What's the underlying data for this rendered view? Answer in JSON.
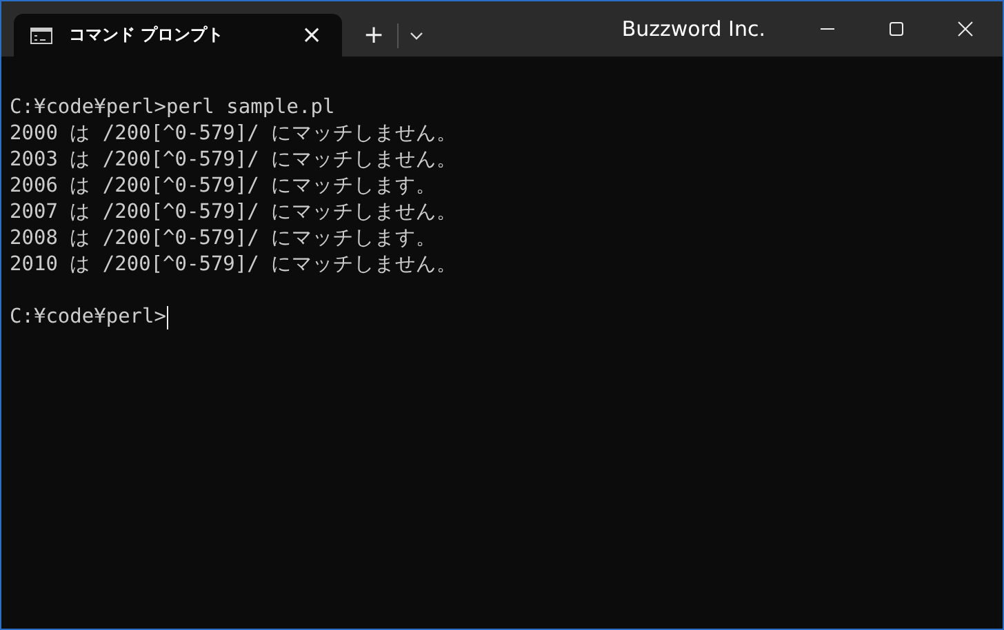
{
  "tabs": [
    {
      "title": "コマンド プロンプト",
      "close": "×",
      "selected": true
    }
  ],
  "new_tab": "+",
  "title_bar": {
    "text": "Buzzword Inc."
  },
  "console": {
    "command": {
      "prompt": "C:¥code¥perl>",
      "input": "perl sample.pl"
    },
    "output": [
      "2000 は /200[^0-579]/ にマッチしません。",
      "2003 は /200[^0-579]/ にマッチしません。",
      "2006 は /200[^0-579]/ にマッチします。",
      "2007 は /200[^0-579]/ にマッチしません。",
      "2008 は /200[^0-579]/ にマッチします。",
      "2010 は /200[^0-579]/ にマッチしません。"
    ],
    "current_prompt": "C:¥code¥perl>"
  }
}
